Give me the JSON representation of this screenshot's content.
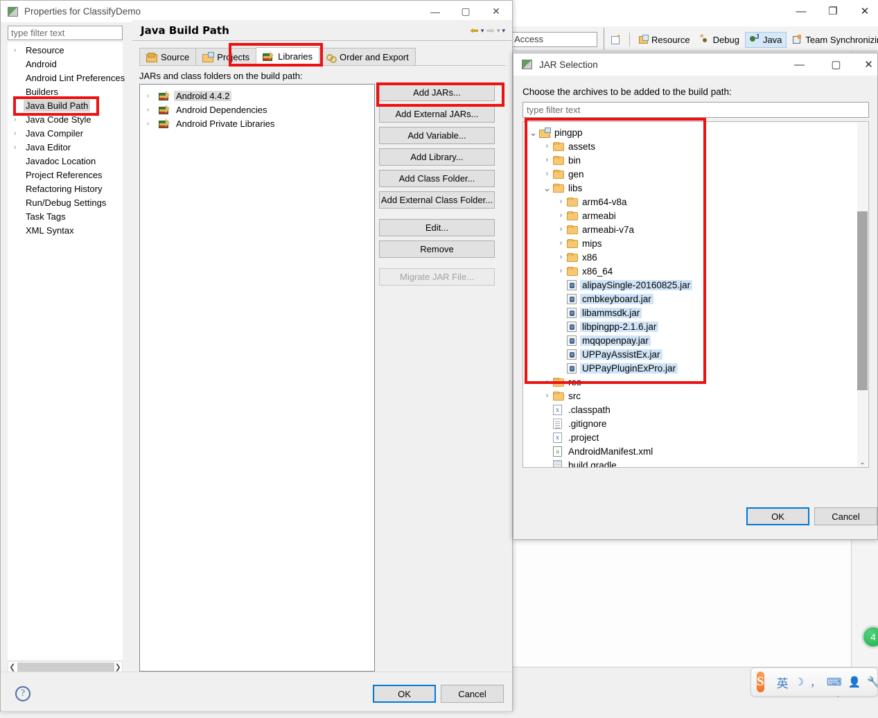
{
  "eclipse": {
    "window_buttons": {
      "minimize": "—",
      "maximize": "❐",
      "close": "✕"
    },
    "quick_access_placeholder": "Quick Access",
    "perspectives": [
      {
        "label": "Resource",
        "icon": "resource-icon",
        "active": false
      },
      {
        "label": "Debug",
        "icon": "debug-icon",
        "active": false
      },
      {
        "label": "Java",
        "icon": "java-icon",
        "active": true
      },
      {
        "label": "Team Synchronizing",
        "icon": "team-sync-icon",
        "active": false
      }
    ],
    "new_perspective_icon": "open-perspective-icon",
    "green_badge_text": "4"
  },
  "ime": {
    "logo": "S",
    "buttons": [
      "英",
      "☽",
      "，",
      "⌨",
      "👤",
      "🔧"
    ]
  },
  "properties_dialog": {
    "title": "Properties for ClassifyDemo",
    "window_buttons": {
      "minimize": "—",
      "maximize": "▢",
      "close": "✕"
    },
    "filter_placeholder": "type filter text",
    "tree_items": [
      {
        "label": "Resource",
        "expandable": true,
        "selected": false
      },
      {
        "label": "Android",
        "expandable": false,
        "selected": false
      },
      {
        "label": "Android Lint Preferences",
        "expandable": false,
        "selected": false
      },
      {
        "label": "Builders",
        "expandable": false,
        "selected": false
      },
      {
        "label": "Java Build Path",
        "expandable": false,
        "selected": true
      },
      {
        "label": "Java Code Style",
        "expandable": true,
        "selected": false
      },
      {
        "label": "Java Compiler",
        "expandable": true,
        "selected": false
      },
      {
        "label": "Java Editor",
        "expandable": true,
        "selected": false
      },
      {
        "label": "Javadoc Location",
        "expandable": false,
        "selected": false
      },
      {
        "label": "Project References",
        "expandable": false,
        "selected": false
      },
      {
        "label": "Refactoring History",
        "expandable": false,
        "selected": false
      },
      {
        "label": "Run/Debug Settings",
        "expandable": false,
        "selected": false
      },
      {
        "label": "Task Tags",
        "expandable": false,
        "selected": false
      },
      {
        "label": "XML Syntax",
        "expandable": false,
        "selected": false
      }
    ],
    "page_title": "Java Build Path",
    "nav": {
      "back": "⬅",
      "back_caret": "▾",
      "forward": "➡",
      "forward_caret": "▾",
      "menu_caret": "▾"
    },
    "tabs": [
      {
        "label": "Source",
        "icon": "source-folder-icon",
        "active": false
      },
      {
        "label": "Projects",
        "icon": "projects-folder-icon",
        "active": false
      },
      {
        "label": "Libraries",
        "icon": "libraries-icon",
        "active": true
      },
      {
        "label": "Order and Export",
        "icon": "order-export-icon",
        "active": false
      }
    ],
    "list_label": "JARs and class folders on the build path:",
    "library_entries": [
      {
        "label": "Android 4.4.2",
        "selected": true
      },
      {
        "label": "Android Dependencies",
        "selected": false
      },
      {
        "label": "Android Private Libraries",
        "selected": false
      }
    ],
    "side_buttons": [
      {
        "label": "Add JARs...",
        "enabled": true,
        "highlighted": true,
        "gap": false
      },
      {
        "label": "Add External JARs...",
        "enabled": true,
        "highlighted": false,
        "gap": false
      },
      {
        "label": "Add Variable...",
        "enabled": true,
        "highlighted": false,
        "gap": false
      },
      {
        "label": "Add Library...",
        "enabled": true,
        "highlighted": false,
        "gap": false
      },
      {
        "label": "Add Class Folder...",
        "enabled": true,
        "highlighted": false,
        "gap": false
      },
      {
        "label": "Add External Class Folder...",
        "enabled": true,
        "highlighted": false,
        "gap": false
      },
      {
        "label": "Edit...",
        "enabled": true,
        "highlighted": false,
        "gap": true
      },
      {
        "label": "Remove",
        "enabled": true,
        "highlighted": false,
        "gap": false
      },
      {
        "label": "Migrate JAR File...",
        "enabled": false,
        "highlighted": false,
        "gap": true
      }
    ],
    "help_icon": "?",
    "ok_label": "OK",
    "cancel_label": "Cancel"
  },
  "jar_selection_dialog": {
    "title": "JAR Selection",
    "window_buttons": {
      "minimize": "—",
      "maximize": "▢",
      "close": "✕"
    },
    "prompt": "Choose the archives to be added to the build path:",
    "filter_placeholder": "type filter text",
    "tree": [
      {
        "label": "pingpp",
        "indent": 0,
        "twisty": "v",
        "icon": "project-folder-icon",
        "selected": false
      },
      {
        "label": "assets",
        "indent": 1,
        "twisty": ">",
        "icon": "folder-icon",
        "selected": false
      },
      {
        "label": "bin",
        "indent": 1,
        "twisty": ">",
        "icon": "folder-icon",
        "selected": false
      },
      {
        "label": "gen",
        "indent": 1,
        "twisty": ">",
        "icon": "folder-icon",
        "selected": false
      },
      {
        "label": "libs",
        "indent": 1,
        "twisty": "v",
        "icon": "folder-icon",
        "selected": false
      },
      {
        "label": "arm64-v8a",
        "indent": 2,
        "twisty": ">",
        "icon": "folder-icon",
        "selected": false
      },
      {
        "label": "armeabi",
        "indent": 2,
        "twisty": ">",
        "icon": "folder-icon",
        "selected": false
      },
      {
        "label": "armeabi-v7a",
        "indent": 2,
        "twisty": ">",
        "icon": "folder-icon",
        "selected": false
      },
      {
        "label": "mips",
        "indent": 2,
        "twisty": ">",
        "icon": "folder-icon",
        "selected": false
      },
      {
        "label": "x86",
        "indent": 2,
        "twisty": ">",
        "icon": "folder-icon",
        "selected": false
      },
      {
        "label": "x86_64",
        "indent": 2,
        "twisty": ">",
        "icon": "folder-icon",
        "selected": false
      },
      {
        "label": "alipaySingle-20160825.jar",
        "indent": 2,
        "twisty": "",
        "icon": "jar-icon",
        "selected": true
      },
      {
        "label": "cmbkeyboard.jar",
        "indent": 2,
        "twisty": "",
        "icon": "jar-icon",
        "selected": true
      },
      {
        "label": "libammsdk.jar",
        "indent": 2,
        "twisty": "",
        "icon": "jar-icon",
        "selected": true
      },
      {
        "label": "libpingpp-2.1.6.jar",
        "indent": 2,
        "twisty": "",
        "icon": "jar-icon",
        "selected": true
      },
      {
        "label": "mqqopenpay.jar",
        "indent": 2,
        "twisty": "",
        "icon": "jar-icon",
        "selected": true
      },
      {
        "label": "UPPayAssistEx.jar",
        "indent": 2,
        "twisty": "",
        "icon": "jar-icon",
        "selected": true
      },
      {
        "label": "UPPayPluginExPro.jar",
        "indent": 2,
        "twisty": "",
        "icon": "jar-icon",
        "selected": true
      },
      {
        "label": "res",
        "indent": 1,
        "twisty": ">",
        "icon": "folder-icon",
        "selected": false
      },
      {
        "label": "src",
        "indent": 1,
        "twisty": ">",
        "icon": "folder-icon",
        "selected": false
      },
      {
        "label": ".classpath",
        "indent": 1,
        "twisty": "",
        "icon": "xml-x-icon",
        "selected": false
      },
      {
        "label": ".gitignore",
        "indent": 1,
        "twisty": "",
        "icon": "text-file-icon",
        "selected": false
      },
      {
        "label": ".project",
        "indent": 1,
        "twisty": "",
        "icon": "xml-x-icon",
        "selected": false
      },
      {
        "label": "AndroidManifest.xml",
        "indent": 1,
        "twisty": "",
        "icon": "xml-icon",
        "selected": false
      },
      {
        "label": "build.gradle",
        "indent": 1,
        "twisty": "",
        "icon": "gradle-icon",
        "selected": false
      }
    ],
    "scroll_down_arrow": "⌄",
    "ok_label": "OK",
    "cancel_label": "Cancel"
  },
  "annotations": {
    "accent_color": "#ee1111",
    "boxes": [
      "java-build-path-tree-item",
      "libraries-tab",
      "add-jars-button",
      "jar-tree-selection"
    ]
  }
}
